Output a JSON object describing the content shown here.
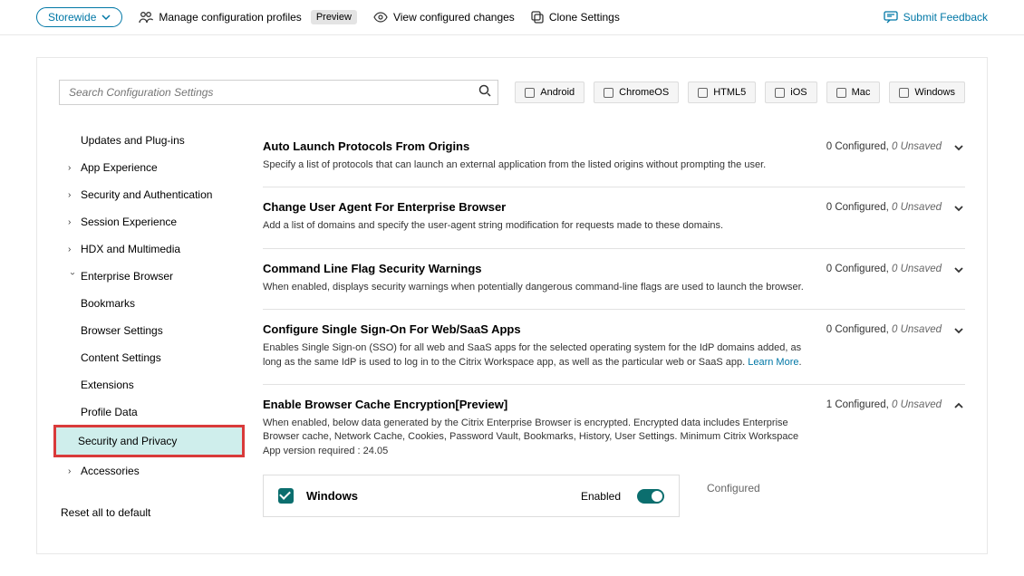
{
  "header": {
    "scope_label": "Storewide",
    "manage_label": "Manage configuration profiles",
    "preview_badge": "Preview",
    "view_changes": "View configured changes",
    "clone_settings": "Clone Settings",
    "feedback": "Submit Feedback"
  },
  "search": {
    "placeholder": "Search Configuration Settings"
  },
  "platforms": [
    "Android",
    "ChromeOS",
    "HTML5",
    "iOS",
    "Mac",
    "Windows"
  ],
  "sidebar": {
    "items": [
      {
        "label": "Updates and Plug-ins",
        "expandable": false
      },
      {
        "label": "App Experience",
        "expandable": true
      },
      {
        "label": "Security and Authentication",
        "expandable": true
      },
      {
        "label": "Session Experience",
        "expandable": true
      },
      {
        "label": "HDX and Multimedia",
        "expandable": true
      },
      {
        "label": "Enterprise Browser",
        "expandable": true,
        "expanded": true
      },
      {
        "label": "Accessories",
        "expandable": true
      }
    ],
    "enterprise_children": [
      "Bookmarks",
      "Browser Settings",
      "Content Settings",
      "Extensions",
      "Profile Data",
      "Security and Privacy"
    ],
    "reset": "Reset all to default"
  },
  "settings": [
    {
      "title": "Auto Launch Protocols From Origins",
      "desc": "Specify a list of protocols that can launch an external application from the listed origins without prompting the user.",
      "configured": 0,
      "unsaved": 0,
      "expanded": false
    },
    {
      "title": "Change User Agent For Enterprise Browser",
      "desc": "Add a list of domains and specify the user-agent string modification for requests made to these domains.",
      "configured": 0,
      "unsaved": 0,
      "expanded": false
    },
    {
      "title": "Command Line Flag Security Warnings",
      "desc": "When enabled, displays security warnings when potentially dangerous command-line flags are used to launch the browser.",
      "configured": 0,
      "unsaved": 0,
      "expanded": false
    },
    {
      "title": "Configure Single Sign-On For Web/SaaS Apps",
      "desc": "Enables Single Sign-on (SSO) for all web and SaaS apps for the selected operating system for the IdP domains added, as long as the same IdP is used to log in to the Citrix Workspace app, as well as the particular web or SaaS app. ",
      "learn_more": "Learn More",
      "configured": 0,
      "unsaved": 0,
      "expanded": false
    },
    {
      "title": "Enable Browser Cache Encryption[Preview]",
      "desc": "When enabled, below data generated by the Citrix Enterprise Browser is encrypted. Encrypted data includes Enterprise Browser cache, Network Cache, Cookies, Password Vault, Bookmarks, History, User Settings. Minimum Citrix Workspace App version required : 24.05",
      "configured": 1,
      "unsaved": 0,
      "expanded": true
    }
  ],
  "expanded_panel": {
    "os": "Windows",
    "enabled_label": "Enabled",
    "status": "Configured"
  },
  "status_template": {
    "configured_word": "Configured,",
    "unsaved_word": "Unsaved"
  }
}
